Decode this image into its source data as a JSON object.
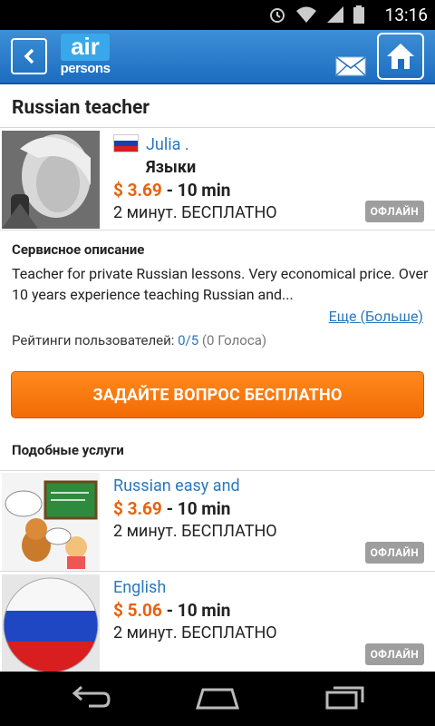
{
  "status_bar": {
    "time": "13:16",
    "icons": [
      "alarm-icon",
      "wifi-icon",
      "signal-icon",
      "battery-icon"
    ]
  },
  "header": {
    "logo_top": "air",
    "logo_bottom": "persons",
    "brand_color": "#1d6dc0"
  },
  "page_title": "Russian teacher",
  "main_listing": {
    "name": "Julia .",
    "category": "Языки",
    "price": "$ 3.69",
    "duration": "- 10 min",
    "free_note": "2 минут. БЕСПЛАТНО",
    "status": "ОФЛАЙН"
  },
  "description": {
    "heading": "Сервисное описание",
    "text": "Teacher for private Russian lessons. Very economical price. Over 10 years experience teaching Russian and...",
    "more_link": "Еще (Больше)"
  },
  "rating": {
    "label": "Рейтинги пользователей:",
    "score": "0/5",
    "votes": "(0 Голоса)"
  },
  "ask_button": "ЗАДАЙТЕ ВОПРОС БЕСПЛАТНО",
  "similar": {
    "heading": "Подобные услуги",
    "items": [
      {
        "name": "Russian easy and",
        "price": "$ 3.69",
        "duration": "- 10 min",
        "free_note": "2 минут. БЕСПЛАТНО",
        "status": "ОФЛАЙН"
      },
      {
        "name": "English",
        "price": "$ 5.06",
        "duration": "- 10 min",
        "free_note": "2 минут. БЕСПЛАТНО",
        "status": "ОФЛАЙН"
      }
    ]
  },
  "colors": {
    "accent_orange": "#f26b05",
    "link_blue": "#2a78be",
    "badge_gray": "#9e9e9e"
  }
}
